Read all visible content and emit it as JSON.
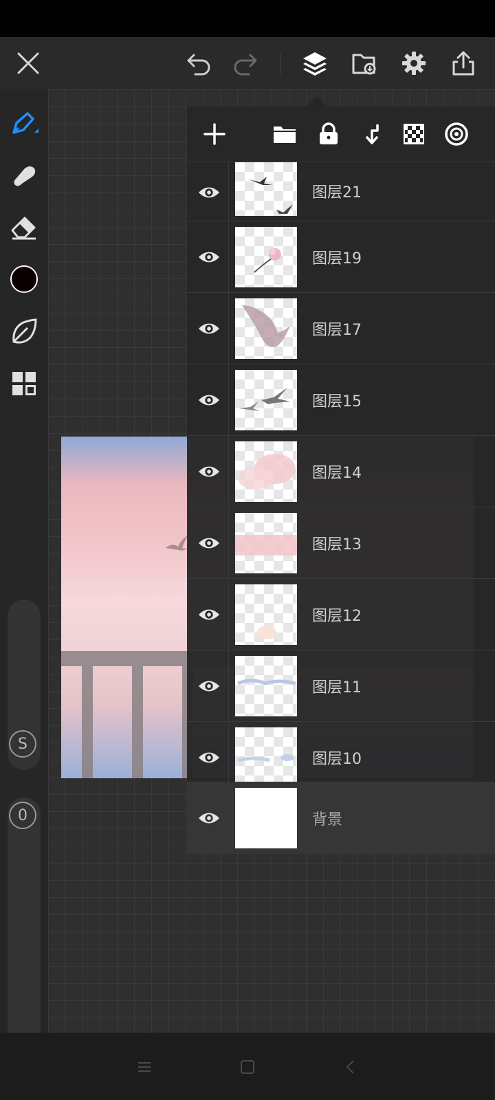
{
  "top_bar": {
    "icons": [
      "close-icon",
      "undo-icon",
      "redo-icon",
      "layers-icon",
      "import-file-icon",
      "settings-icon",
      "share-icon"
    ]
  },
  "left_toolbar": {
    "tools": [
      "pen-tool-icon",
      "smudge-tool-icon",
      "eraser-tool-icon",
      "color-swatch",
      "brush-library-icon",
      "gallery-icon"
    ],
    "current_color": "#0a0000",
    "size_slider_label": "S",
    "opacity_slider_label": "0"
  },
  "layer_panel": {
    "toolbar_icons": [
      "add-layer-icon",
      "folder-icon",
      "lock-icon",
      "merge-down-icon",
      "transparency-icon",
      "reference-icon"
    ],
    "layers": [
      {
        "name": "图层21",
        "thumb": "birds"
      },
      {
        "name": "图层19",
        "thumb": "flower"
      },
      {
        "name": "图层17",
        "thumb": "bird-large"
      },
      {
        "name": "图层15",
        "thumb": "birds-2"
      },
      {
        "name": "图层14",
        "thumb": "pink-cloud"
      },
      {
        "name": "图层13",
        "thumb": "pink-strip"
      },
      {
        "name": "图层12",
        "thumb": "faint"
      },
      {
        "name": "图层11",
        "thumb": "blue-wisps"
      },
      {
        "name": "图层10",
        "thumb": "blue-clouds"
      },
      {
        "name": "背景",
        "thumb": "white"
      }
    ]
  },
  "nav_bar": {
    "icons": [
      "menu-nav-icon",
      "home-nav-icon",
      "back-nav-icon"
    ]
  }
}
